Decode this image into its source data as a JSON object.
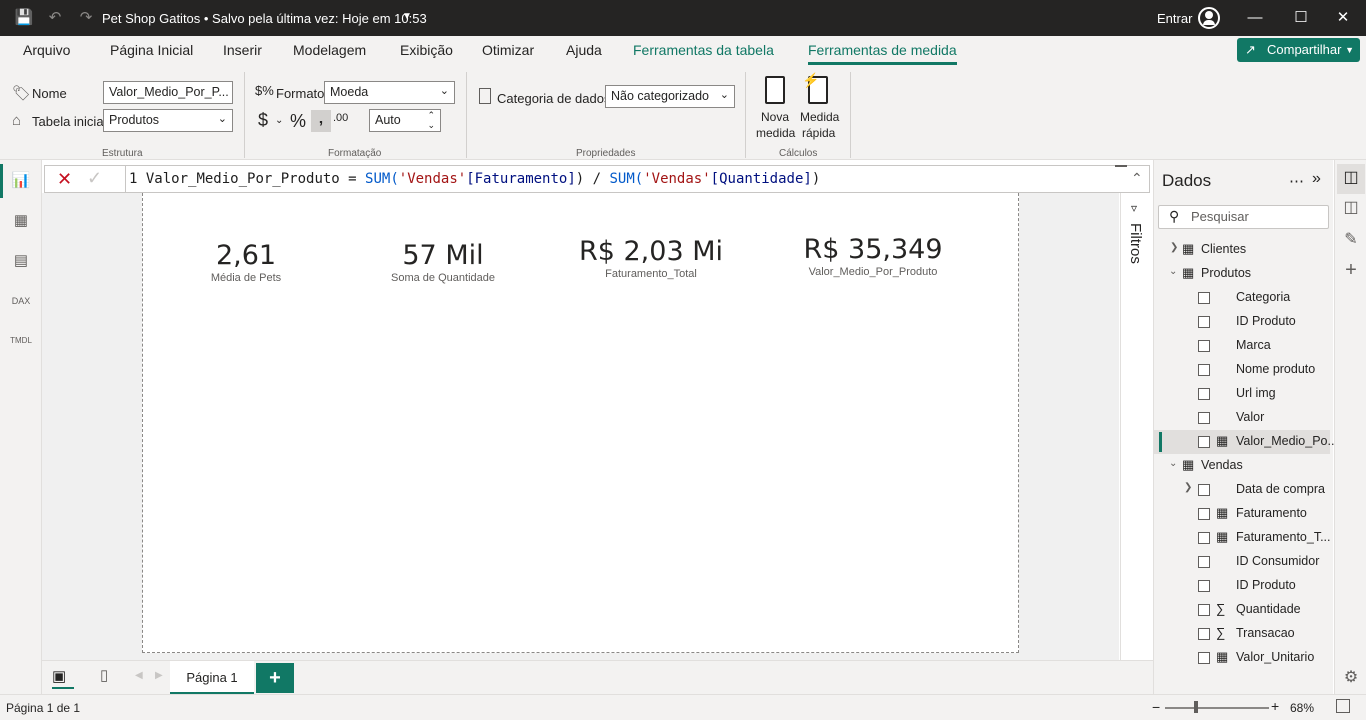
{
  "titlebar": {
    "title": "Pet Shop Gatitos • Salvo pela última vez: Hoje em 10:53",
    "sign_in": "Entrar"
  },
  "menu": {
    "items": [
      "Arquivo",
      "Página Inicial",
      "Inserir",
      "Modelagem",
      "Exibição",
      "Otimizar",
      "Ajuda",
      "Ferramentas da tabela",
      "Ferramentas de medida"
    ],
    "share": "Compartilhar"
  },
  "ribbon": {
    "name_label": "Nome",
    "name_value": "Valor_Medio_Por_P...",
    "home_table_label": "Tabela inicial",
    "home_table_value": "Produtos",
    "group_structure": "Estrutura",
    "format_label": "Formato",
    "format_value": "Moeda",
    "currency": "$",
    "percent": "%",
    "decimals_value": "Auto",
    "group_formatting": "Formatação",
    "category_label": "Categoria de dados",
    "category_value": "Não categorizado",
    "group_properties": "Propriedades",
    "new_measure_1": "Nova",
    "new_measure_2": "medida",
    "quick_measure_1": "Medida",
    "quick_measure_2": "rápida",
    "group_calculations": "Cálculos"
  },
  "formula": {
    "line": "1",
    "measure": "Valor_Medio_Por_Produto",
    "op": " = ",
    "fn1": "SUM(",
    "tbl1": "'Vendas'",
    "col1": "[Faturamento]",
    "mid": ") / ",
    "fn2": "SUM(",
    "tbl2": "'Vendas'",
    "col2": "[Quantidade]",
    "end": ")"
  },
  "cards": [
    {
      "value": "2,61",
      "label": "Média de Pets"
    },
    {
      "value": "57 Mil",
      "label": "Soma de Quantidade"
    },
    {
      "value": "R$ 2,03 Mi",
      "label": "Faturamento_Total"
    },
    {
      "value": "R$ 35,349",
      "label": "Valor_Medio_Por_Produto"
    }
  ],
  "filters": {
    "label": "Filtros"
  },
  "data_pane": {
    "title": "Dados",
    "search_placeholder": "Pesquisar",
    "clientes": "Clientes",
    "produtos": "Produtos",
    "produtos_fields": [
      "Categoria",
      "ID Produto",
      "Marca",
      "Nome produto",
      "Url img",
      "Valor",
      "Valor_Medio_Po..."
    ],
    "vendas": "Vendas",
    "vendas_fields": [
      "Data de compra",
      "Faturamento",
      "Faturamento_T...",
      "ID Consumidor",
      "ID Produto",
      "Quantidade",
      "Transacao",
      "Valor_Unitario"
    ]
  },
  "tabs": {
    "page1": "Página 1"
  },
  "status": {
    "page": "Página 1 de 1",
    "zoom": "68%"
  }
}
